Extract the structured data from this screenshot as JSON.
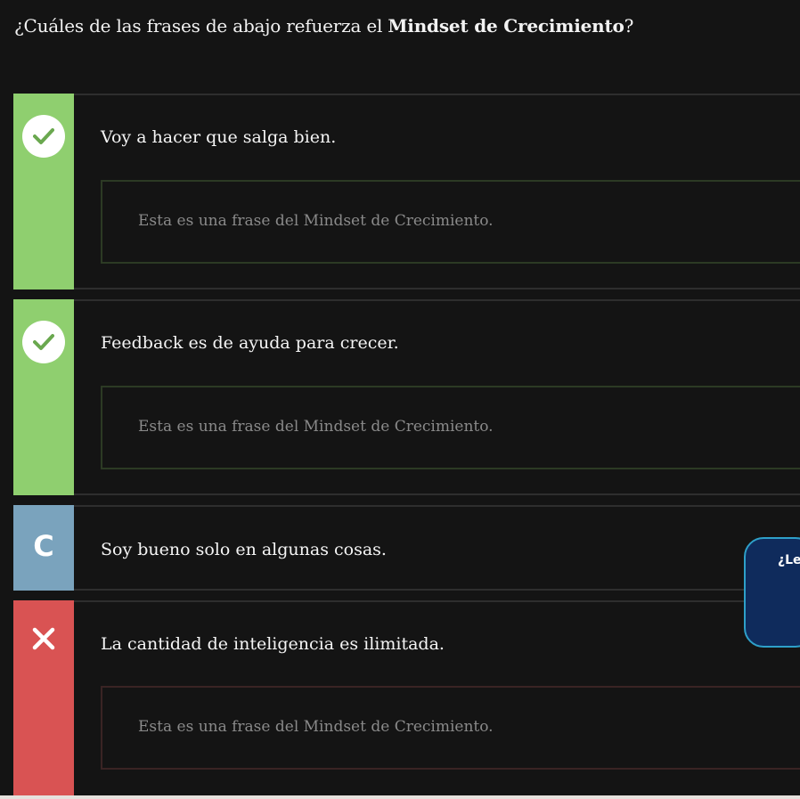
{
  "question": {
    "prefix": "¿Cuáles de las frases de abajo refuerza el ",
    "emphasis": "Mindset de Crecimiento",
    "suffix": "?"
  },
  "options": [
    {
      "status": "correct",
      "icon": "check-icon",
      "text": "Voy a hacer que salga bien.",
      "feedback": "Esta es una frase del Mindset de Crecimiento."
    },
    {
      "status": "correct",
      "icon": "check-icon",
      "text": "Feedback es de ayuda para crecer.",
      "feedback": "Esta es una frase del Mindset de Crecimiento."
    },
    {
      "status": "unanswered",
      "letter": "C",
      "text": "Soy bueno solo en algunas cosas."
    },
    {
      "status": "wrong",
      "icon": "close-icon",
      "text": "La cantidad de inteligencia es ilimitada.",
      "feedback": "Esta es una frase del Mindset de Crecimiento."
    }
  ],
  "tooltip": {
    "label": "¿Le"
  },
  "colors": {
    "correct": "#8fcf6f",
    "unanswered": "#7aa3bd",
    "wrong": "#d95353",
    "tooltip_bg": "#0f2b5c",
    "tooltip_border": "#2ea0c9"
  }
}
